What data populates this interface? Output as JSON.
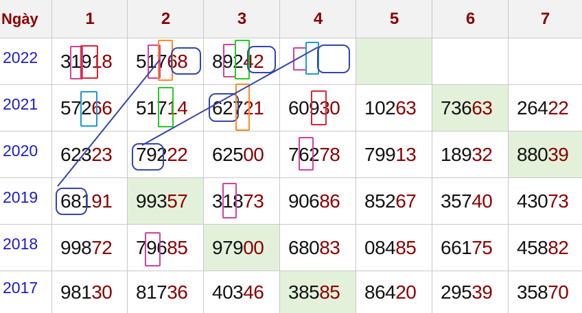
{
  "header": {
    "day_label": "Ngày",
    "columns": [
      "1",
      "2",
      "3",
      "4",
      "5",
      "6",
      "7"
    ]
  },
  "rows": [
    {
      "year": "2022",
      "cells": [
        {
          "a": "319",
          "b": "18"
        },
        {
          "a": "517",
          "b": "68"
        },
        {
          "a": "892",
          "b": "42"
        },
        {
          "a": "",
          "b": ""
        },
        {
          "a": "",
          "b": "",
          "hl": true
        },
        {
          "a": "",
          "b": ""
        },
        {
          "a": "",
          "b": ""
        }
      ]
    },
    {
      "year": "2021",
      "cells": [
        {
          "a": "572",
          "b": "66"
        },
        {
          "a": "517",
          "b": "14"
        },
        {
          "a": "627",
          "b": "21"
        },
        {
          "a": "609",
          "b": "30"
        },
        {
          "a": "102",
          "b": "63"
        },
        {
          "a": "736",
          "b": "63",
          "hl": true
        },
        {
          "a": "264",
          "b": "22"
        }
      ]
    },
    {
      "year": "2020",
      "cells": [
        {
          "a": "623",
          "b": "23"
        },
        {
          "a": "792",
          "b": "22"
        },
        {
          "a": "625",
          "b": "00"
        },
        {
          "a": "762",
          "b": "78"
        },
        {
          "a": "799",
          "b": "13"
        },
        {
          "a": "189",
          "b": "32"
        },
        {
          "a": "880",
          "b": "39",
          "hl": true
        }
      ]
    },
    {
      "year": "2019",
      "cells": [
        {
          "a": "681",
          "b": "91"
        },
        {
          "a": "993",
          "b": "57",
          "hl": true
        },
        {
          "a": "318",
          "b": "73"
        },
        {
          "a": "906",
          "b": "86"
        },
        {
          "a": "852",
          "b": "67"
        },
        {
          "a": "357",
          "b": "40"
        },
        {
          "a": "430",
          "b": "73"
        }
      ]
    },
    {
      "year": "2018",
      "cells": [
        {
          "a": "998",
          "b": "72"
        },
        {
          "a": "796",
          "b": "85"
        },
        {
          "a": "979",
          "b": "00",
          "hl": true
        },
        {
          "a": "680",
          "b": "83"
        },
        {
          "a": "084",
          "b": "85"
        },
        {
          "a": "661",
          "b": "75"
        },
        {
          "a": "458",
          "b": "82"
        }
      ]
    },
    {
      "year": "2017",
      "cells": [
        {
          "a": "981",
          "b": "30"
        },
        {
          "a": "817",
          "b": "36"
        },
        {
          "a": "403",
          "b": "46"
        },
        {
          "a": "385",
          "b": "85",
          "hl": true
        },
        {
          "a": "864",
          "b": "20"
        },
        {
          "a": "295",
          "b": "39"
        },
        {
          "a": "358",
          "b": "70"
        }
      ]
    }
  ],
  "colors": {
    "header_text": "#8b0000",
    "year_text": "#1a1acc",
    "highlight_bg": "#e3f1da",
    "pink": "#d040a0",
    "blue_box": "#3344aa",
    "green": "#22cc22",
    "orange": "#ff8a1f",
    "red": "#dd2233",
    "cyan": "#1a9ad6"
  }
}
